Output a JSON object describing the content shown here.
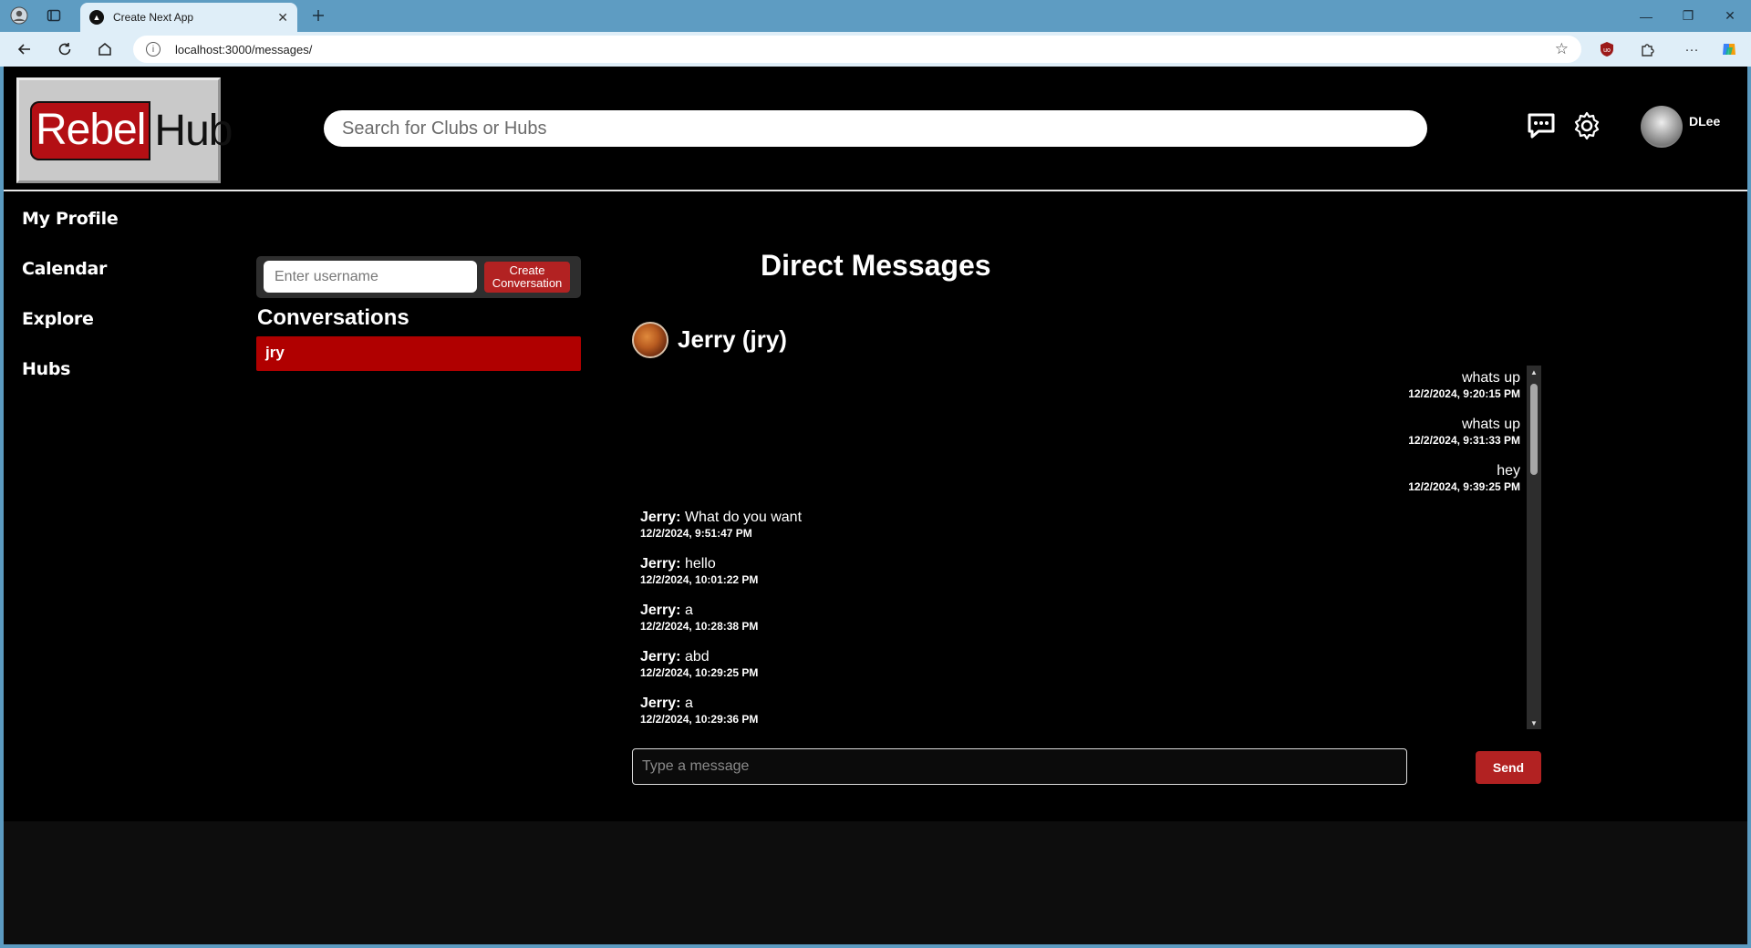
{
  "browser": {
    "tab_title": "Create Next App",
    "url": "localhost:3000/messages/"
  },
  "header": {
    "logo_left": "Rebel",
    "logo_right": "Hub",
    "search_placeholder": "Search for Clubs or Hubs",
    "username": "DLee"
  },
  "sidebar": {
    "items": [
      {
        "label": "My Profile"
      },
      {
        "label": "Calendar"
      },
      {
        "label": "Explore"
      },
      {
        "label": "Hubs"
      }
    ]
  },
  "conversations": {
    "username_placeholder": "Enter username",
    "create_label": "Create Conversation",
    "title": "Conversations",
    "items": [
      {
        "label": "jry"
      }
    ]
  },
  "chat": {
    "title": "Direct Messages",
    "partner": "Jerry (jry)",
    "messages": [
      {
        "mine": true,
        "sender": "",
        "text": "whats up",
        "time": "12/2/2024, 9:20:15 PM"
      },
      {
        "mine": true,
        "sender": "",
        "text": "whats up",
        "time": "12/2/2024, 9:31:33 PM"
      },
      {
        "mine": true,
        "sender": "",
        "text": "hey",
        "time": "12/2/2024, 9:39:25 PM"
      },
      {
        "mine": false,
        "sender": "Jerry:",
        "text": "What do you want",
        "time": "12/2/2024, 9:51:47 PM"
      },
      {
        "mine": false,
        "sender": "Jerry:",
        "text": "hello",
        "time": "12/2/2024, 10:01:22 PM"
      },
      {
        "mine": false,
        "sender": "Jerry:",
        "text": "a",
        "time": "12/2/2024, 10:28:38 PM"
      },
      {
        "mine": false,
        "sender": "Jerry:",
        "text": "abd",
        "time": "12/2/2024, 10:29:25 PM"
      },
      {
        "mine": false,
        "sender": "Jerry:",
        "text": "a",
        "time": "12/2/2024, 10:29:36 PM"
      }
    ],
    "input_placeholder": "Type a message",
    "send_label": "Send"
  }
}
